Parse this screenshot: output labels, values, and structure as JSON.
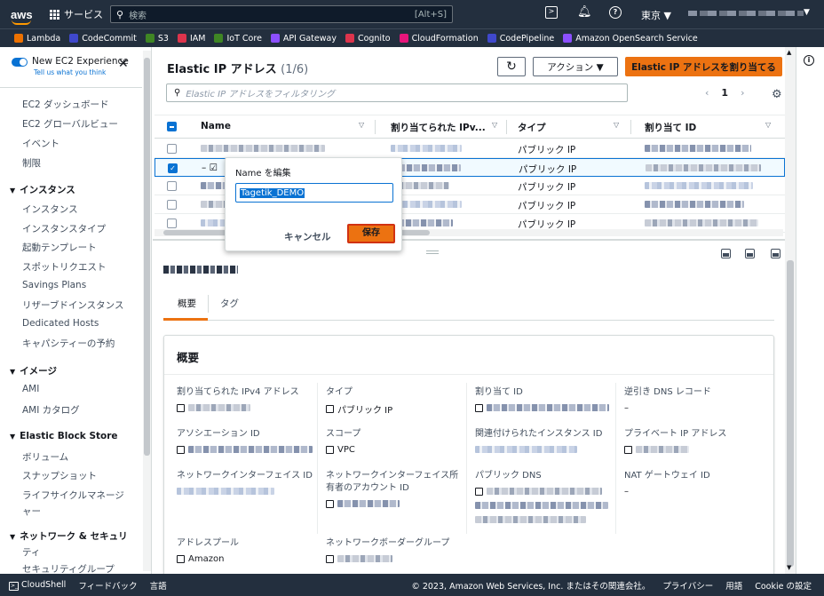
{
  "topnav": {
    "logo": "aws",
    "services": "サービス",
    "search_placeholder": "検索",
    "search_shortcut": "[Alt+S]",
    "region": "東京 ▼",
    "account_dd": "▼"
  },
  "favorites": [
    {
      "label": "Lambda",
      "color": "#ed7100"
    },
    {
      "label": "CodeCommit",
      "color": "#3f48cc"
    },
    {
      "label": "S3",
      "color": "#3f8624"
    },
    {
      "label": "IAM",
      "color": "#dd344c"
    },
    {
      "label": "IoT Core",
      "color": "#3f8624"
    },
    {
      "label": "API Gateway",
      "color": "#8c4fff"
    },
    {
      "label": "Cognito",
      "color": "#dd344c"
    },
    {
      "label": "CloudFormation",
      "color": "#e7157b"
    },
    {
      "label": "CodePipeline",
      "color": "#3f48cc"
    },
    {
      "label": "Amazon OpenSearch Service",
      "color": "#8c4fff"
    }
  ],
  "sidebar": {
    "new_exp": "New EC2 Experience",
    "new_exp_sub": "Tell us what you think",
    "close": "✕",
    "items": {
      "dashboard": "EC2 ダッシュボード",
      "global": "EC2 グローバルビュー",
      "events": "イベント",
      "limits": "制限",
      "sec_instances": "インスタンス",
      "instances": "インスタンス",
      "instance_types": "インスタンスタイプ",
      "launch_templates": "起動テンプレート",
      "spot": "スポットリクエスト",
      "savings": "Savings Plans",
      "reserved": "リザーブドインスタンス",
      "dedicated": "Dedicated Hosts",
      "capacity": "キャパシティーの予約",
      "sec_images": "イメージ",
      "ami": "AMI",
      "ami_catalog": "AMI カタログ",
      "sec_ebs": "Elastic Block Store",
      "volumes": "ボリューム",
      "snapshots": "スナップショット",
      "lifecycle1": "ライフサイクルマネージ",
      "lifecycle2": "ャー",
      "sec_network1": "ネットワーク & セキュリ",
      "sec_network2": "ティ",
      "security_groups": "セキュリティグループ"
    }
  },
  "header": {
    "title": "Elastic IP アドレス",
    "count": "(1/6)",
    "refresh": "↻",
    "actions": "アクション ▼",
    "allocate": "Elastic IP アドレスを割り当てる"
  },
  "filter": {
    "placeholder": "Elastic IP アドレスをフィルタリング"
  },
  "pager": {
    "prev": "‹",
    "page": "1",
    "next": "›"
  },
  "table": {
    "headers": {
      "name": "Name",
      "ipv4": "割り当てられた IPv...",
      "type": "タイプ",
      "alloc": "割り当て ID"
    },
    "rows": [
      {
        "name_prefix": "",
        "type": "パブリック IP",
        "selected": false
      },
      {
        "name_prefix": "– ☑",
        "type": "パブリック IP",
        "selected": true
      },
      {
        "name_prefix": "",
        "type": "パブリック IP",
        "selected": false
      },
      {
        "name_prefix": "",
        "type": "パブリック IP",
        "selected": false
      },
      {
        "name_prefix": "",
        "type": "パブリック IP",
        "selected": false
      }
    ]
  },
  "popover": {
    "title": "Name を編集",
    "value": "Tagetik_DEMO",
    "cancel": "キャンセル",
    "save": "保存"
  },
  "details": {
    "tabs": {
      "overview": "概要",
      "tags": "タグ"
    },
    "card_title": "概要",
    "fields": {
      "ipv4": "割り当てられた IPv4 アドレス",
      "type": "タイプ",
      "type_val": "パブリック IP",
      "alloc": "割り当て ID",
      "rdns": "逆引き DNS レコード",
      "rdns_val": "–",
      "assoc": "アソシエーション ID",
      "scope": "スコープ",
      "scope_val": "VPC",
      "assoc_inst": "関連付けられたインスタンス ID",
      "priv_ip": "プライベート IP アドレス",
      "eni": "ネットワークインターフェイス ID",
      "eni_owner1": "ネットワークインターフェイス所",
      "eni_owner2": "有者のアカウント ID",
      "pub_dns": "パブリック DNS",
      "nat": "NAT ゲートウェイ ID",
      "nat_val": "–",
      "pool": "アドレスプール",
      "pool_val": "Amazon",
      "border": "ネットワークボーダーグループ"
    }
  },
  "footer": {
    "cloudshell": "CloudShell",
    "feedback": "フィードバック",
    "language": "言語",
    "copyright": "© 2023, Amazon Web Services, Inc. またはその関連会社。",
    "privacy": "プライバシー",
    "terms": "用語",
    "cookies": "Cookie の設定"
  }
}
